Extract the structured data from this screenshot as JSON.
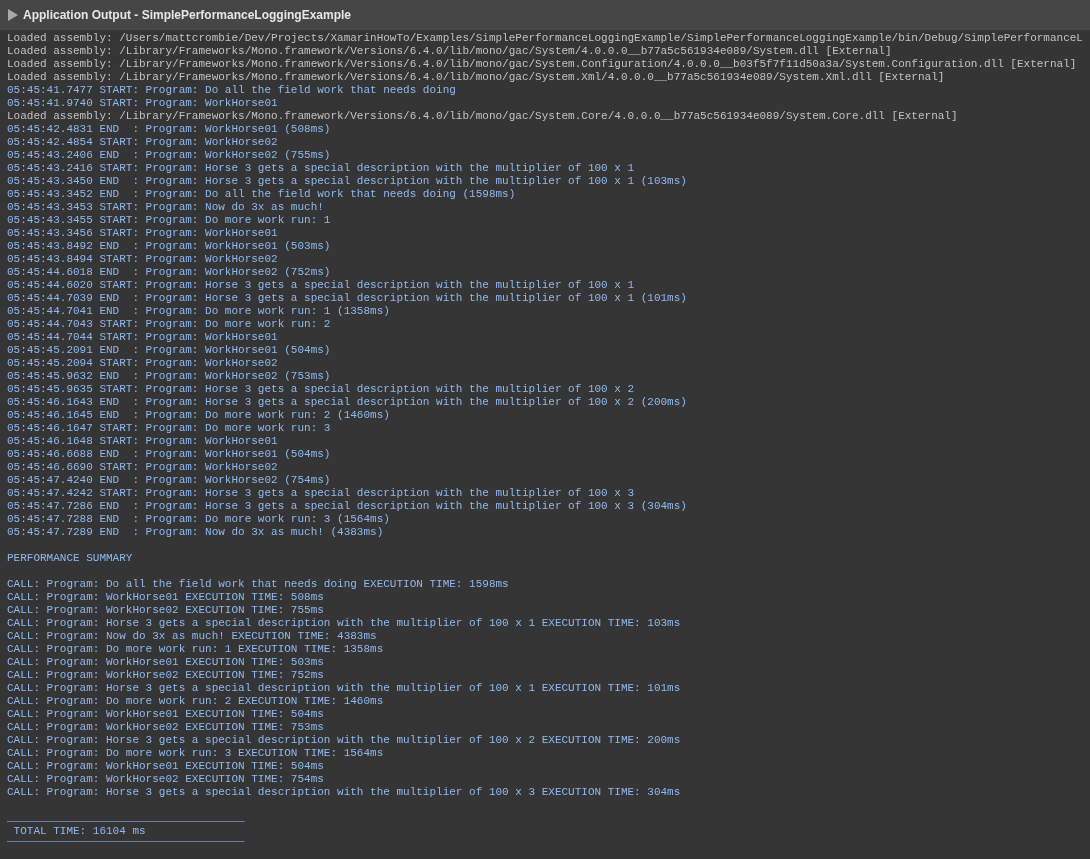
{
  "panel": {
    "title": "Application Output - SimplePerformanceLoggingExample"
  },
  "log": [
    {
      "kind": "system",
      "text": "Loaded assembly: /Users/mattcrombie/Dev/Projects/XamarinHowTo/Examples/SimplePerformanceLoggingExample/SimplePerformanceLoggingExample/bin/Debug/SimplePerformanceL"
    },
    {
      "kind": "system",
      "text": "Loaded assembly: /Library/Frameworks/Mono.framework/Versions/6.4.0/lib/mono/gac/System/4.0.0.0__b77a5c561934e089/System.dll [External]"
    },
    {
      "kind": "system",
      "text": "Loaded assembly: /Library/Frameworks/Mono.framework/Versions/6.4.0/lib/mono/gac/System.Configuration/4.0.0.0__b03f5f7f11d50a3a/System.Configuration.dll [External]"
    },
    {
      "kind": "system",
      "text": "Loaded assembly: /Library/Frameworks/Mono.framework/Versions/6.4.0/lib/mono/gac/System.Xml/4.0.0.0__b77a5c561934e089/System.Xml.dll [External]"
    },
    {
      "kind": "output",
      "text": "05:45:41.7477 START: Program: Do all the field work that needs doing"
    },
    {
      "kind": "output",
      "text": "05:45:41.9740 START: Program: WorkHorse01"
    },
    {
      "kind": "system",
      "text": "Loaded assembly: /Library/Frameworks/Mono.framework/Versions/6.4.0/lib/mono/gac/System.Core/4.0.0.0__b77a5c561934e089/System.Core.dll [External]"
    },
    {
      "kind": "output",
      "text": "05:45:42.4831 END  : Program: WorkHorse01 (508ms)"
    },
    {
      "kind": "output",
      "text": "05:45:42.4854 START: Program: WorkHorse02"
    },
    {
      "kind": "output",
      "text": "05:45:43.2406 END  : Program: WorkHorse02 (755ms)"
    },
    {
      "kind": "output",
      "text": "05:45:43.2416 START: Program: Horse 3 gets a special description with the multiplier of 100 x 1"
    },
    {
      "kind": "output",
      "text": "05:45:43.3450 END  : Program: Horse 3 gets a special description with the multiplier of 100 x 1 (103ms)"
    },
    {
      "kind": "output",
      "text": "05:45:43.3452 END  : Program: Do all the field work that needs doing (1598ms)"
    },
    {
      "kind": "output",
      "text": "05:45:43.3453 START: Program: Now do 3x as much!"
    },
    {
      "kind": "output",
      "text": "05:45:43.3455 START: Program: Do more work run: 1"
    },
    {
      "kind": "output",
      "text": "05:45:43.3456 START: Program: WorkHorse01"
    },
    {
      "kind": "output",
      "text": "05:45:43.8492 END  : Program: WorkHorse01 (503ms)"
    },
    {
      "kind": "output",
      "text": "05:45:43.8494 START: Program: WorkHorse02"
    },
    {
      "kind": "output",
      "text": "05:45:44.6018 END  : Program: WorkHorse02 (752ms)"
    },
    {
      "kind": "output",
      "text": "05:45:44.6020 START: Program: Horse 3 gets a special description with the multiplier of 100 x 1"
    },
    {
      "kind": "output",
      "text": "05:45:44.7039 END  : Program: Horse 3 gets a special description with the multiplier of 100 x 1 (101ms)"
    },
    {
      "kind": "output",
      "text": "05:45:44.7041 END  : Program: Do more work run: 1 (1358ms)"
    },
    {
      "kind": "output",
      "text": "05:45:44.7043 START: Program: Do more work run: 2"
    },
    {
      "kind": "output",
      "text": "05:45:44.7044 START: Program: WorkHorse01"
    },
    {
      "kind": "output",
      "text": "05:45:45.2091 END  : Program: WorkHorse01 (504ms)"
    },
    {
      "kind": "output",
      "text": "05:45:45.2094 START: Program: WorkHorse02"
    },
    {
      "kind": "output",
      "text": "05:45:45.9632 END  : Program: WorkHorse02 (753ms)"
    },
    {
      "kind": "output",
      "text": "05:45:45.9635 START: Program: Horse 3 gets a special description with the multiplier of 100 x 2"
    },
    {
      "kind": "output",
      "text": "05:45:46.1643 END  : Program: Horse 3 gets a special description with the multiplier of 100 x 2 (200ms)"
    },
    {
      "kind": "output",
      "text": "05:45:46.1645 END  : Program: Do more work run: 2 (1460ms)"
    },
    {
      "kind": "output",
      "text": "05:45:46.1647 START: Program: Do more work run: 3"
    },
    {
      "kind": "output",
      "text": "05:45:46.1648 START: Program: WorkHorse01"
    },
    {
      "kind": "output",
      "text": "05:45:46.6688 END  : Program: WorkHorse01 (504ms)"
    },
    {
      "kind": "output",
      "text": "05:45:46.6690 START: Program: WorkHorse02"
    },
    {
      "kind": "output",
      "text": "05:45:47.4240 END  : Program: WorkHorse02 (754ms)"
    },
    {
      "kind": "output",
      "text": "05:45:47.4242 START: Program: Horse 3 gets a special description with the multiplier of 100 x 3"
    },
    {
      "kind": "output",
      "text": "05:45:47.7286 END  : Program: Horse 3 gets a special description with the multiplier of 100 x 3 (304ms)"
    },
    {
      "kind": "output",
      "text": "05:45:47.7288 END  : Program: Do more work run: 3 (1564ms)"
    },
    {
      "kind": "output",
      "text": "05:45:47.7289 END  : Program: Now do 3x as much! (4383ms)"
    }
  ],
  "summary": {
    "heading": "PERFORMANCE SUMMARY",
    "calls": [
      "CALL: Program: Do all the field work that needs doing EXECUTION TIME: 1598ms",
      "CALL: Program: WorkHorse01 EXECUTION TIME: 508ms",
      "CALL: Program: WorkHorse02 EXECUTION TIME: 755ms",
      "CALL: Program: Horse 3 gets a special description with the multiplier of 100 x 1 EXECUTION TIME: 103ms",
      "CALL: Program: Now do 3x as much! EXECUTION TIME: 4383ms",
      "CALL: Program: Do more work run: 1 EXECUTION TIME: 1358ms",
      "CALL: Program: WorkHorse01 EXECUTION TIME: 503ms",
      "CALL: Program: WorkHorse02 EXECUTION TIME: 752ms",
      "CALL: Program: Horse 3 gets a special description with the multiplier of 100 x 1 EXECUTION TIME: 101ms",
      "CALL: Program: Do more work run: 2 EXECUTION TIME: 1460ms",
      "CALL: Program: WorkHorse01 EXECUTION TIME: 504ms",
      "CALL: Program: WorkHorse02 EXECUTION TIME: 753ms",
      "CALL: Program: Horse 3 gets a special description with the multiplier of 100 x 2 EXECUTION TIME: 200ms",
      "CALL: Program: Do more work run: 3 EXECUTION TIME: 1564ms",
      "CALL: Program: WorkHorse01 EXECUTION TIME: 504ms",
      "CALL: Program: WorkHorse02 EXECUTION TIME: 754ms",
      "CALL: Program: Horse 3 gets a special description with the multiplier of 100 x 3 EXECUTION TIME: 304ms"
    ],
    "rule_top": "____________________________________",
    "total": " TOTAL TIME: 16104 ms",
    "rule_bottom": "____________________________________"
  }
}
